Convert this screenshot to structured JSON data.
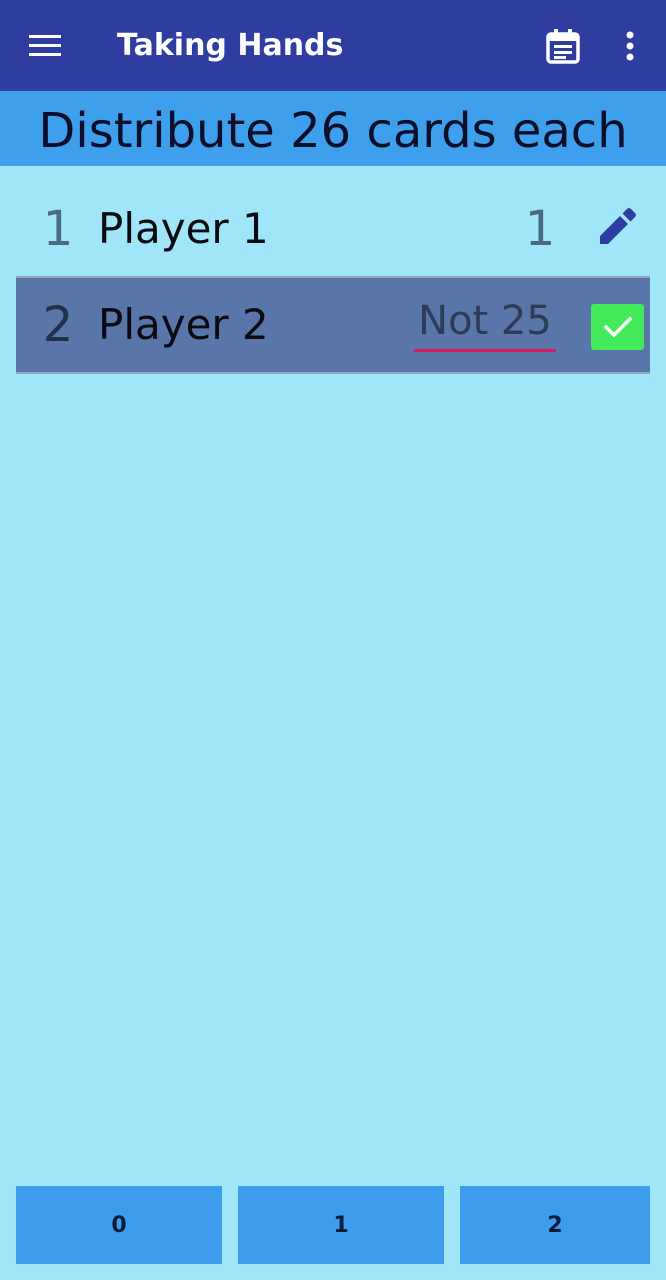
{
  "app": {
    "title": "Taking Hands"
  },
  "toolbar": {
    "menu_icon": "hamburger-menu-icon",
    "calendar_icon": "calendar-note-icon",
    "more_icon": "more-vertical-icon"
  },
  "banner": {
    "text": "Distribute 26 cards each"
  },
  "players": [
    {
      "number": "1",
      "name": "Player 1",
      "score": "1",
      "action_icon": "pencil-edit-icon"
    },
    {
      "number": "2",
      "name": "Player 2",
      "input_placeholder": "Not 25",
      "input_value": "",
      "action_icon": "checkmark-icon"
    }
  ],
  "bid_buttons": [
    {
      "label": "0"
    },
    {
      "label": "1"
    },
    {
      "label": "2"
    }
  ],
  "colors": {
    "appbar": "#2f3da0",
    "banner": "#3e9fec",
    "background": "#a0e6f8",
    "selected_row": "#5876a8",
    "confirm": "#43ea5a",
    "input_underline": "#d81b60",
    "edit_icon": "#2f3da0"
  }
}
